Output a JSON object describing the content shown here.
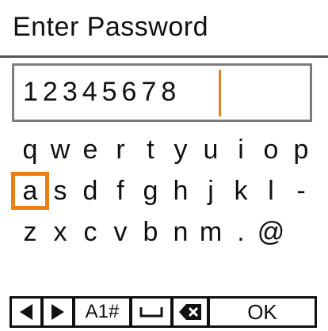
{
  "header": {
    "title": "Enter Password"
  },
  "password_field": {
    "value": "12345678",
    "cursor_color": "#e87c18"
  },
  "keyboard": {
    "rows": [
      [
        "q",
        "w",
        "e",
        "r",
        "t",
        "y",
        "u",
        "i",
        "o",
        "p"
      ],
      [
        "a",
        "s",
        "d",
        "f",
        "g",
        "h",
        "j",
        "k",
        "l",
        "-"
      ],
      [
        "z",
        "x",
        "c",
        "v",
        "b",
        "n",
        "m",
        ".",
        "@"
      ]
    ],
    "selected_key": "a",
    "selection_color": "#f07d11"
  },
  "toolbar": {
    "left_icon": "arrow-left-icon",
    "right_icon": "arrow-right-icon",
    "mode_label": "A1#",
    "space_icon": "space-icon",
    "delete_icon": "backspace-icon",
    "ok_label": "OK"
  }
}
